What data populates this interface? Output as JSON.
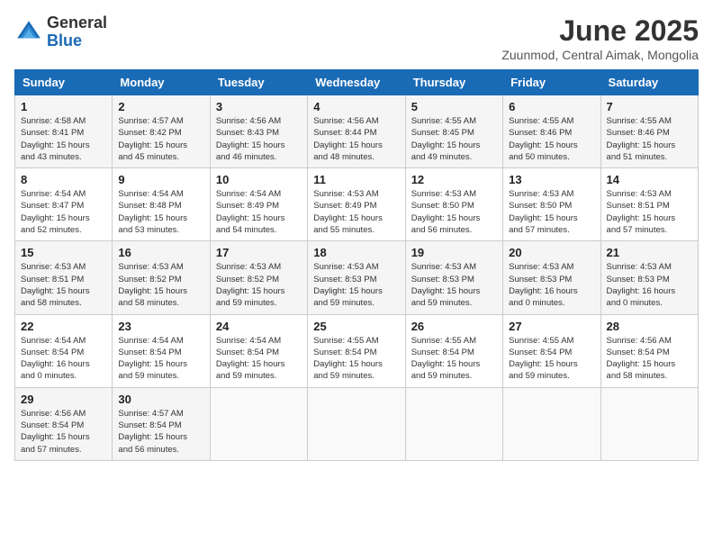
{
  "header": {
    "logo_general": "General",
    "logo_blue": "Blue",
    "month_title": "June 2025",
    "subtitle": "Zuunmod, Central Aimak, Mongolia"
  },
  "weekdays": [
    "Sunday",
    "Monday",
    "Tuesday",
    "Wednesday",
    "Thursday",
    "Friday",
    "Saturday"
  ],
  "weeks": [
    [
      {
        "day": "1",
        "info": "Sunrise: 4:58 AM\nSunset: 8:41 PM\nDaylight: 15 hours\nand 43 minutes."
      },
      {
        "day": "2",
        "info": "Sunrise: 4:57 AM\nSunset: 8:42 PM\nDaylight: 15 hours\nand 45 minutes."
      },
      {
        "day": "3",
        "info": "Sunrise: 4:56 AM\nSunset: 8:43 PM\nDaylight: 15 hours\nand 46 minutes."
      },
      {
        "day": "4",
        "info": "Sunrise: 4:56 AM\nSunset: 8:44 PM\nDaylight: 15 hours\nand 48 minutes."
      },
      {
        "day": "5",
        "info": "Sunrise: 4:55 AM\nSunset: 8:45 PM\nDaylight: 15 hours\nand 49 minutes."
      },
      {
        "day": "6",
        "info": "Sunrise: 4:55 AM\nSunset: 8:46 PM\nDaylight: 15 hours\nand 50 minutes."
      },
      {
        "day": "7",
        "info": "Sunrise: 4:55 AM\nSunset: 8:46 PM\nDaylight: 15 hours\nand 51 minutes."
      }
    ],
    [
      {
        "day": "8",
        "info": "Sunrise: 4:54 AM\nSunset: 8:47 PM\nDaylight: 15 hours\nand 52 minutes."
      },
      {
        "day": "9",
        "info": "Sunrise: 4:54 AM\nSunset: 8:48 PM\nDaylight: 15 hours\nand 53 minutes."
      },
      {
        "day": "10",
        "info": "Sunrise: 4:54 AM\nSunset: 8:49 PM\nDaylight: 15 hours\nand 54 minutes."
      },
      {
        "day": "11",
        "info": "Sunrise: 4:53 AM\nSunset: 8:49 PM\nDaylight: 15 hours\nand 55 minutes."
      },
      {
        "day": "12",
        "info": "Sunrise: 4:53 AM\nSunset: 8:50 PM\nDaylight: 15 hours\nand 56 minutes."
      },
      {
        "day": "13",
        "info": "Sunrise: 4:53 AM\nSunset: 8:50 PM\nDaylight: 15 hours\nand 57 minutes."
      },
      {
        "day": "14",
        "info": "Sunrise: 4:53 AM\nSunset: 8:51 PM\nDaylight: 15 hours\nand 57 minutes."
      }
    ],
    [
      {
        "day": "15",
        "info": "Sunrise: 4:53 AM\nSunset: 8:51 PM\nDaylight: 15 hours\nand 58 minutes."
      },
      {
        "day": "16",
        "info": "Sunrise: 4:53 AM\nSunset: 8:52 PM\nDaylight: 15 hours\nand 58 minutes."
      },
      {
        "day": "17",
        "info": "Sunrise: 4:53 AM\nSunset: 8:52 PM\nDaylight: 15 hours\nand 59 minutes."
      },
      {
        "day": "18",
        "info": "Sunrise: 4:53 AM\nSunset: 8:53 PM\nDaylight: 15 hours\nand 59 minutes."
      },
      {
        "day": "19",
        "info": "Sunrise: 4:53 AM\nSunset: 8:53 PM\nDaylight: 15 hours\nand 59 minutes."
      },
      {
        "day": "20",
        "info": "Sunrise: 4:53 AM\nSunset: 8:53 PM\nDaylight: 16 hours\nand 0 minutes."
      },
      {
        "day": "21",
        "info": "Sunrise: 4:53 AM\nSunset: 8:53 PM\nDaylight: 16 hours\nand 0 minutes."
      }
    ],
    [
      {
        "day": "22",
        "info": "Sunrise: 4:54 AM\nSunset: 8:54 PM\nDaylight: 16 hours\nand 0 minutes."
      },
      {
        "day": "23",
        "info": "Sunrise: 4:54 AM\nSunset: 8:54 PM\nDaylight: 15 hours\nand 59 minutes."
      },
      {
        "day": "24",
        "info": "Sunrise: 4:54 AM\nSunset: 8:54 PM\nDaylight: 15 hours\nand 59 minutes."
      },
      {
        "day": "25",
        "info": "Sunrise: 4:55 AM\nSunset: 8:54 PM\nDaylight: 15 hours\nand 59 minutes."
      },
      {
        "day": "26",
        "info": "Sunrise: 4:55 AM\nSunset: 8:54 PM\nDaylight: 15 hours\nand 59 minutes."
      },
      {
        "day": "27",
        "info": "Sunrise: 4:55 AM\nSunset: 8:54 PM\nDaylight: 15 hours\nand 59 minutes."
      },
      {
        "day": "28",
        "info": "Sunrise: 4:56 AM\nSunset: 8:54 PM\nDaylight: 15 hours\nand 58 minutes."
      }
    ],
    [
      {
        "day": "29",
        "info": "Sunrise: 4:56 AM\nSunset: 8:54 PM\nDaylight: 15 hours\nand 57 minutes."
      },
      {
        "day": "30",
        "info": "Sunrise: 4:57 AM\nSunset: 8:54 PM\nDaylight: 15 hours\nand 56 minutes."
      },
      null,
      null,
      null,
      null,
      null
    ]
  ]
}
